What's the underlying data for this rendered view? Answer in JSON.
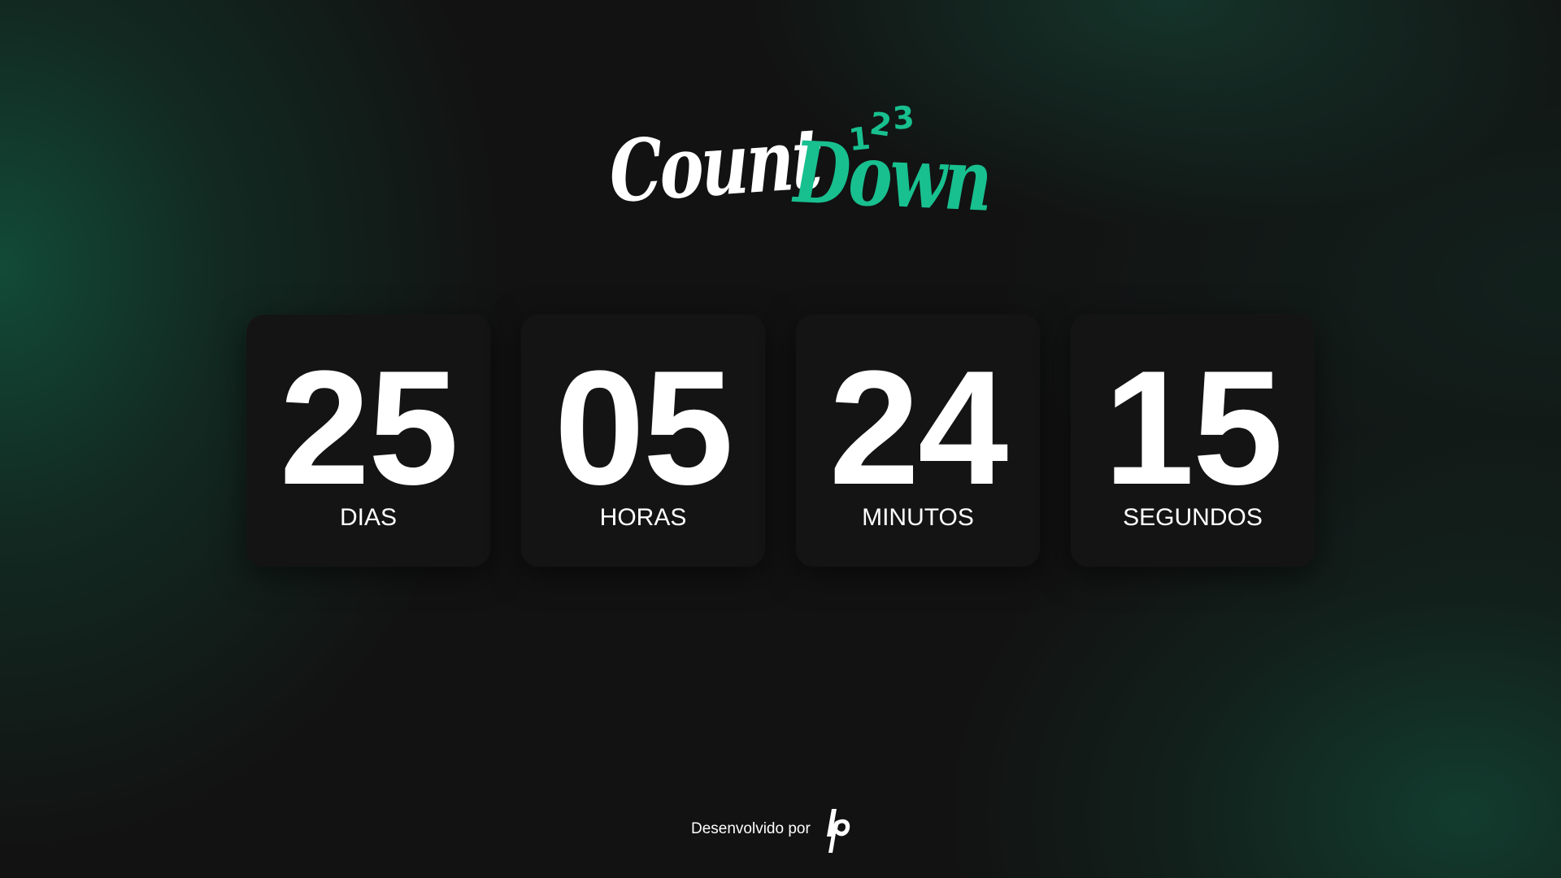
{
  "logo": {
    "word1": "Count",
    "word2": "Down",
    "digits": [
      "1",
      "2",
      "3"
    ],
    "accent_color": "#18c08f"
  },
  "countdown": [
    {
      "value": "25",
      "label": "DIAS"
    },
    {
      "value": "05",
      "label": "HORAS"
    },
    {
      "value": "24",
      "label": "MINUTOS"
    },
    {
      "value": "15",
      "label": "SEGUNDOS"
    }
  ],
  "footer": {
    "text": "Desenvolvido por",
    "brand_mark": "lp"
  },
  "colors": {
    "background": "#121212",
    "card": "#141414",
    "accent": "#18c08f",
    "glow": "#12543e"
  }
}
